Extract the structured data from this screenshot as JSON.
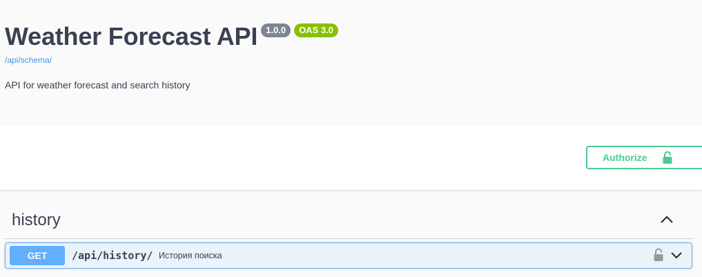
{
  "info": {
    "title": "Weather Forecast API",
    "version_badge": "1.0.0",
    "oas_badge": "OAS 3.0",
    "schema_link": "/api/schema/",
    "description": "API for weather forecast and search history"
  },
  "auth": {
    "authorize_label": "Authorize",
    "icon": "unlocked-padlock-icon"
  },
  "tags": [
    {
      "name": "history",
      "expanded": true,
      "operations": [
        {
          "method": "GET",
          "path": "/api/history/",
          "summary": "История поиска",
          "lock_icon": "unlocked-padlock-icon",
          "expand_icon": "chevron-down-icon"
        }
      ]
    }
  ],
  "colors": {
    "get": "#61affe",
    "authorize": "#49cc90",
    "version_badge": "#7d8492",
    "oas_badge": "#89bf04",
    "link": "#4990e2",
    "text": "#3b4151"
  }
}
